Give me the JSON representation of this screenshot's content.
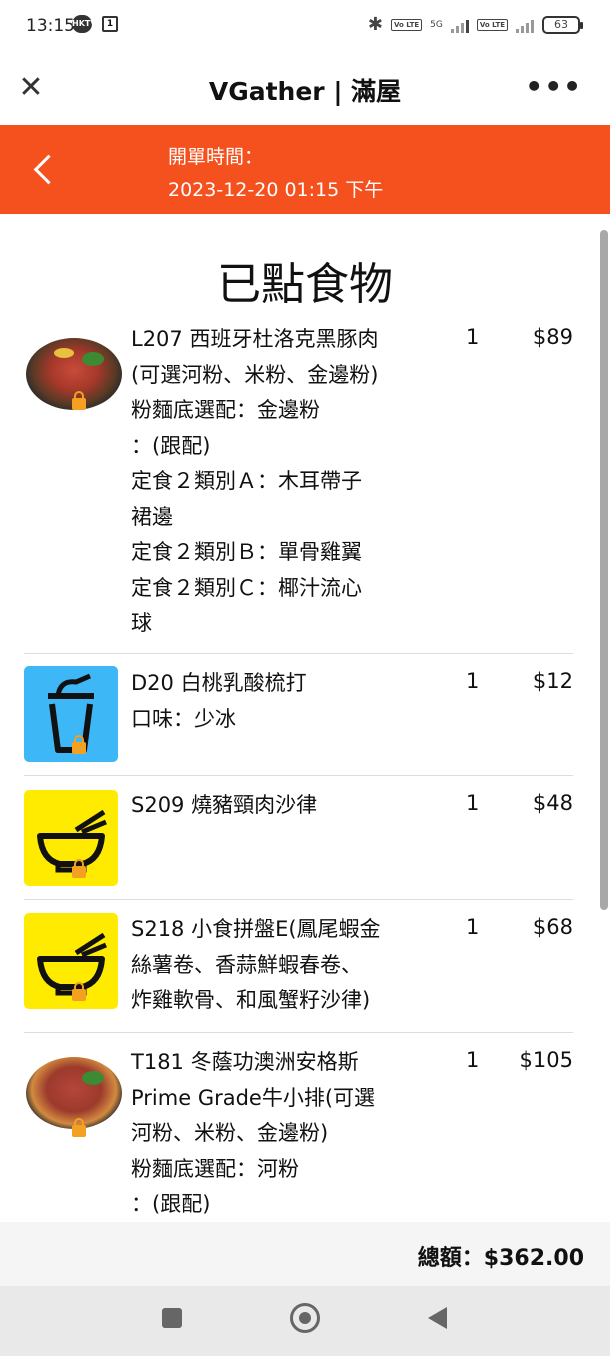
{
  "status_bar": {
    "time": "13:15",
    "notif_badge": "HKTV",
    "square_icon_label": "1",
    "network": "5G",
    "volte1": "Vo LTE",
    "volte2": "Vo LTE",
    "battery": "63"
  },
  "app_bar": {
    "title": "VGather | 滿屋",
    "close_icon": "close-icon",
    "more_icon": "more-horizontal-icon",
    "more_glyph": "•••"
  },
  "banner": {
    "open_label": "開單時間：",
    "open_time": "2023-12-20 01:15 下午",
    "color": "#F4511E"
  },
  "section_title": "已點食物",
  "items": [
    {
      "desc": "L207 西班牙杜洛克黑豚肉\n(可選河粉、米粉、金邊粉)\n粉麵底選配：金邊粉\n：(跟配)\n定食２類別Ａ：木耳帶子\n裙邊\n定食２類別Ｂ：單骨雞翼\n定食２類別Ｃ：椰汁流心\n球",
      "qty": "1",
      "price": "$89",
      "image": "noodle-dish-photo"
    },
    {
      "desc": "D20 白桃乳酸梳打\n口味：少冰",
      "qty": "1",
      "price": "$12",
      "image": "drink-cup-icon"
    },
    {
      "desc": "S209 燒豬頸肉沙律",
      "qty": "1",
      "price": "$48",
      "image": "bowl-chopsticks-icon"
    },
    {
      "desc": "S218 小食拼盤E(鳳尾蝦金\n絲薯卷、香蒜鮮蝦春卷、\n炸雞軟骨、和風蟹籽沙律)",
      "qty": "1",
      "price": "$68",
      "image": "bowl-chopsticks-icon"
    },
    {
      "desc": "T181 冬蔭功澳洲安格斯\nPrime Grade牛小排(可選\n河粉、米粉、金邊粉)\n粉麵底選配：河粉\n：(跟配)",
      "qty": "1",
      "price": "$105",
      "image": "beef-noodle-photo"
    }
  ],
  "footer": {
    "total_label": "總額：",
    "total_value": "$362.00"
  }
}
